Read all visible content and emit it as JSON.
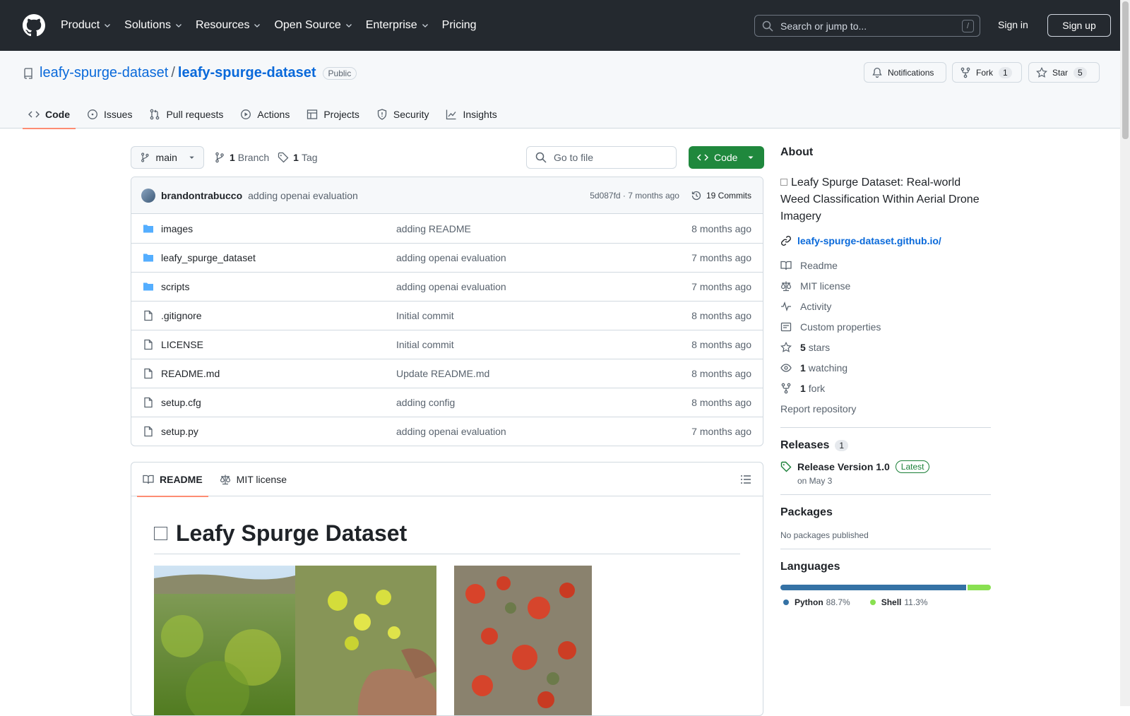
{
  "header": {
    "nav": [
      "Product",
      "Solutions",
      "Resources",
      "Open Source",
      "Enterprise",
      "Pricing"
    ],
    "search_placeholder": "Search or jump to...",
    "search_shortcut": "/",
    "sign_in": "Sign in",
    "sign_up": "Sign up"
  },
  "repo": {
    "owner": "leafy-spurge-dataset",
    "separator": "/",
    "name": "leafy-spurge-dataset",
    "visibility": "Public",
    "notifications": "Notifications",
    "fork_label": "Fork",
    "fork_count": "1",
    "star_label": "Star",
    "star_count": "5"
  },
  "tabs": [
    "Code",
    "Issues",
    "Pull requests",
    "Actions",
    "Projects",
    "Security",
    "Insights"
  ],
  "toolbar": {
    "branch": "main",
    "branch_count": "1",
    "branch_label": "Branch",
    "tag_count": "1",
    "tag_label": "Tag",
    "goto_placeholder": "Go to file",
    "code_button": "Code"
  },
  "commit": {
    "author": "brandontrabucco",
    "message": "adding openai evaluation",
    "hash_time": "5d087fd · 7 months ago",
    "commits": "19 Commits"
  },
  "files": [
    {
      "name": "images",
      "type": "dir",
      "message": "adding README",
      "time": "8 months ago"
    },
    {
      "name": "leafy_spurge_dataset",
      "type": "dir",
      "message": "adding openai evaluation",
      "time": "7 months ago"
    },
    {
      "name": "scripts",
      "type": "dir",
      "message": "adding openai evaluation",
      "time": "7 months ago"
    },
    {
      "name": ".gitignore",
      "type": "file",
      "message": "Initial commit",
      "time": "8 months ago"
    },
    {
      "name": "LICENSE",
      "type": "file",
      "message": "Initial commit",
      "time": "8 months ago"
    },
    {
      "name": "README.md",
      "type": "file",
      "message": "Update README.md",
      "time": "8 months ago"
    },
    {
      "name": "setup.cfg",
      "type": "file",
      "message": "adding config",
      "time": "8 months ago"
    },
    {
      "name": "setup.py",
      "type": "file",
      "message": "adding openai evaluation",
      "time": "7 months ago"
    }
  ],
  "readme": {
    "tab_readme": "README",
    "tab_license": "MIT license",
    "title": "Leafy Spurge Dataset"
  },
  "about": {
    "heading": "About",
    "description": "Leafy Spurge Dataset: Real-world Weed Classification Within Aerial Drone Imagery",
    "link": "leafy-spurge-dataset.github.io/",
    "readme": "Readme",
    "license": "MIT license",
    "activity": "Activity",
    "custom_properties": "Custom properties",
    "stars_count": "5",
    "stars_label": "stars",
    "watching_count": "1",
    "watching_label": "watching",
    "fork_count": "1",
    "fork_label": "fork",
    "report": "Report repository"
  },
  "releases": {
    "heading": "Releases",
    "count": "1",
    "name": "Release Version 1.0",
    "badge": "Latest",
    "date": "on May 3"
  },
  "packages": {
    "heading": "Packages",
    "text": "No packages published"
  },
  "languages": {
    "heading": "Languages",
    "items": [
      {
        "name": "Python",
        "percent": "88.7%",
        "value": 88.7,
        "color": "#3572A5"
      },
      {
        "name": "Shell",
        "percent": "11.3%",
        "value": 11.3,
        "color": "#89e051"
      }
    ]
  }
}
